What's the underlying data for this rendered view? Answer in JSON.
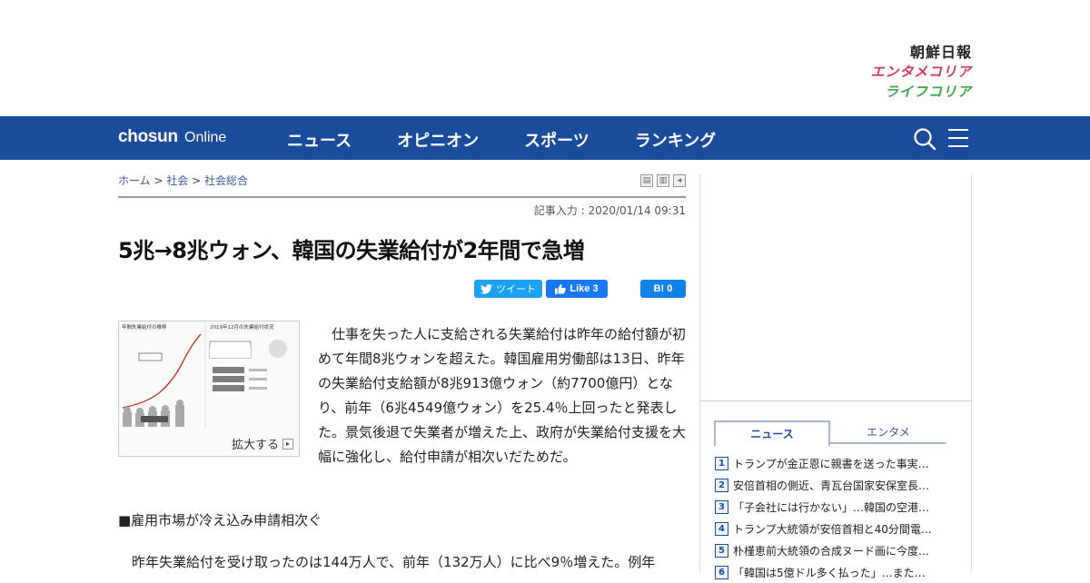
{
  "brands": {
    "chosun": "朝鮮日報",
    "entame": "エンタメコリア",
    "life": "ライフコリア"
  },
  "nav": {
    "logo_bold": "chosun",
    "logo_light": "Online",
    "items": [
      {
        "label": "ニュース"
      },
      {
        "label": "オピニオン"
      },
      {
        "label": "スポーツ"
      },
      {
        "label": "ランキング"
      }
    ]
  },
  "breadcrumb": {
    "home": "ホーム",
    "sep1": " > ",
    "section": "社会",
    "sep2": " > ",
    "subsection": "社会総合"
  },
  "article": {
    "dateline": "記事入力 : 2020/01/14 09:31",
    "headline": "5兆→8兆ウォン、韓国の失業給付が2年間で急増",
    "tweet_label": "ツイート",
    "like_label": "Like 3",
    "hatena_label": "B! 0",
    "figure_caption": "拡大する",
    "figure_title_left": "年間失業給付の推移",
    "figure_title_right": "2019年12月の失業給付状況",
    "body_1": "　仕事を失った人に支給される失業給付は昨年の給付額が初めて年間8兆ウォンを超えた。韓国雇用労働部は13日、昨年の失業給付支給額が8兆913億ウォン（約7700億円）となり、前年（6兆4549億ウォン）を25.4％上回ったと発表した。景気後退で失業者が増えた上、政府が失業給付支援を大幅に強化し、給付申請が相次いだためだ。",
    "subhead": "■雇用市場が冷え込み申請相次ぐ",
    "body_2": "　昨年失業給付を受け取ったのは144万人で、前年（132万人）に比べ9％増えた。例年"
  },
  "sidebar": {
    "tabs": [
      {
        "label": "ニュース"
      },
      {
        "label": "エンタメ"
      }
    ],
    "ranking": [
      {
        "num": "1",
        "text": "トランプが金正恩に親書を送った事実…"
      },
      {
        "num": "2",
        "text": "安倍首相の側近、青瓦台国家安保室長…"
      },
      {
        "num": "3",
        "text": "「子会社には行かない」…韓国の空港…"
      },
      {
        "num": "4",
        "text": "トランプ大統領が安倍首相と40分間電…"
      },
      {
        "num": "5",
        "text": "朴槿恵前大統領の合成ヌード画に今度…"
      },
      {
        "num": "6",
        "text": "「韓国は5億ドル多く払った」…また…"
      }
    ]
  },
  "colors": {
    "nav_bg": "#1b4c9c",
    "entame": "#d03a5a",
    "life": "#3ca64a",
    "tweet": "#1da1f2",
    "like": "#1877f2",
    "hatena": "#1083e8"
  }
}
